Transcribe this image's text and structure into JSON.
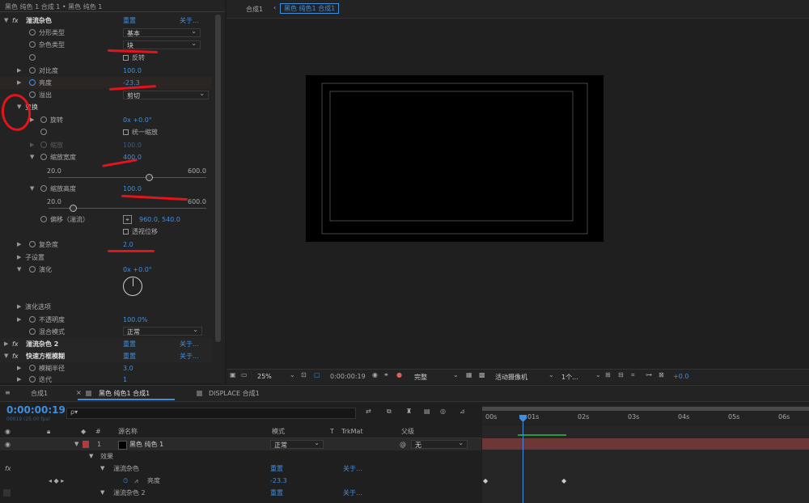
{
  "effects_panel": {
    "breadcrumb": "黑色 纯色 1 合成 1 • 黑色 纯色 1",
    "fx_label": "fx",
    "effect1": {
      "name": "湍流杂色",
      "reset": "重置",
      "about": "关于..."
    },
    "rows": {
      "fractal_type": {
        "label": "分形类型",
        "value": "基本"
      },
      "noise_type": {
        "label": "杂色类型",
        "value": "块"
      },
      "invert": {
        "label": "反转"
      },
      "contrast": {
        "label": "对比度",
        "value": "100.0"
      },
      "brightness": {
        "label": "亮度",
        "value": "-23.3"
      },
      "overflow": {
        "label": "溢出",
        "value": "剪切"
      },
      "transform": {
        "label": "变换"
      },
      "rotation": {
        "label": "旋转",
        "value": "0x +0.0°"
      },
      "uniform_scale": {
        "label": "统一缩放"
      },
      "scale": {
        "label": "缩放",
        "value": "100.0"
      },
      "scale_width": {
        "label": "缩放宽度",
        "value": "400.0",
        "min": "20.0",
        "max": "600.0"
      },
      "scale_height": {
        "label": "缩放高度",
        "value": "100.0",
        "min": "20.0",
        "max": "600.0"
      },
      "offset": {
        "label": "偏移（湍流）",
        "value": "960.0, 540.0"
      },
      "perspective": {
        "label": "透视位移"
      },
      "complexity": {
        "label": "复杂度",
        "value": "2.0"
      },
      "sub_settings": {
        "label": "子设置"
      },
      "evolution": {
        "label": "演化",
        "value": "0x +0.0°"
      },
      "evolution_options": {
        "label": "演化选项"
      },
      "opacity": {
        "label": "不透明度",
        "value": "100.0%"
      },
      "blend_mode": {
        "label": "混合模式",
        "value": "正常"
      }
    },
    "effect2": {
      "name": "湍流杂色 2",
      "reset": "重置",
      "about": "关于..."
    },
    "effect3": {
      "name": "快速方框模糊",
      "reset": "重置",
      "about": "关于..."
    },
    "blur_radius": {
      "label": "模糊半径",
      "value": "3.0"
    },
    "iterations": {
      "label": "迭代",
      "value": "1"
    }
  },
  "viewer": {
    "tab_comp": "合成1",
    "tab_active": "黑色 纯色1 合成1",
    "zoom": "25%",
    "timecode": "0:00:00:19",
    "resolution": "完整",
    "camera": "活动摄像机",
    "views": "1个...",
    "exposure": "+0.0"
  },
  "timeline": {
    "tabs": [
      "合成1",
      "黑色 纯色1 合成1",
      "DISPLACE 合成1"
    ],
    "current_time": "0:00:00:19",
    "frames": "00019 (25.00 fps)",
    "search_placeholder": "ρ▾",
    "headers": {
      "num": "#",
      "source": "源名称",
      "mode": "模式",
      "t": "T",
      "trkmat": "TrkMat",
      "parent": "父级"
    },
    "layer": {
      "num": "1",
      "name": "黑色 纯色 1",
      "mode": "正常",
      "parent": "无"
    },
    "effects_group": "效果",
    "fx_row1": {
      "name": "湍流杂色",
      "reset": "重置",
      "about": "关于..."
    },
    "brightness_row": {
      "label": "亮度",
      "value": "-23.3"
    },
    "fx_row2": {
      "name": "湍流杂色 2",
      "reset": "重置",
      "about": "关于..."
    },
    "ruler": [
      "00s",
      "01s",
      "02s",
      "03s",
      "04s",
      "05s",
      "06s"
    ]
  }
}
